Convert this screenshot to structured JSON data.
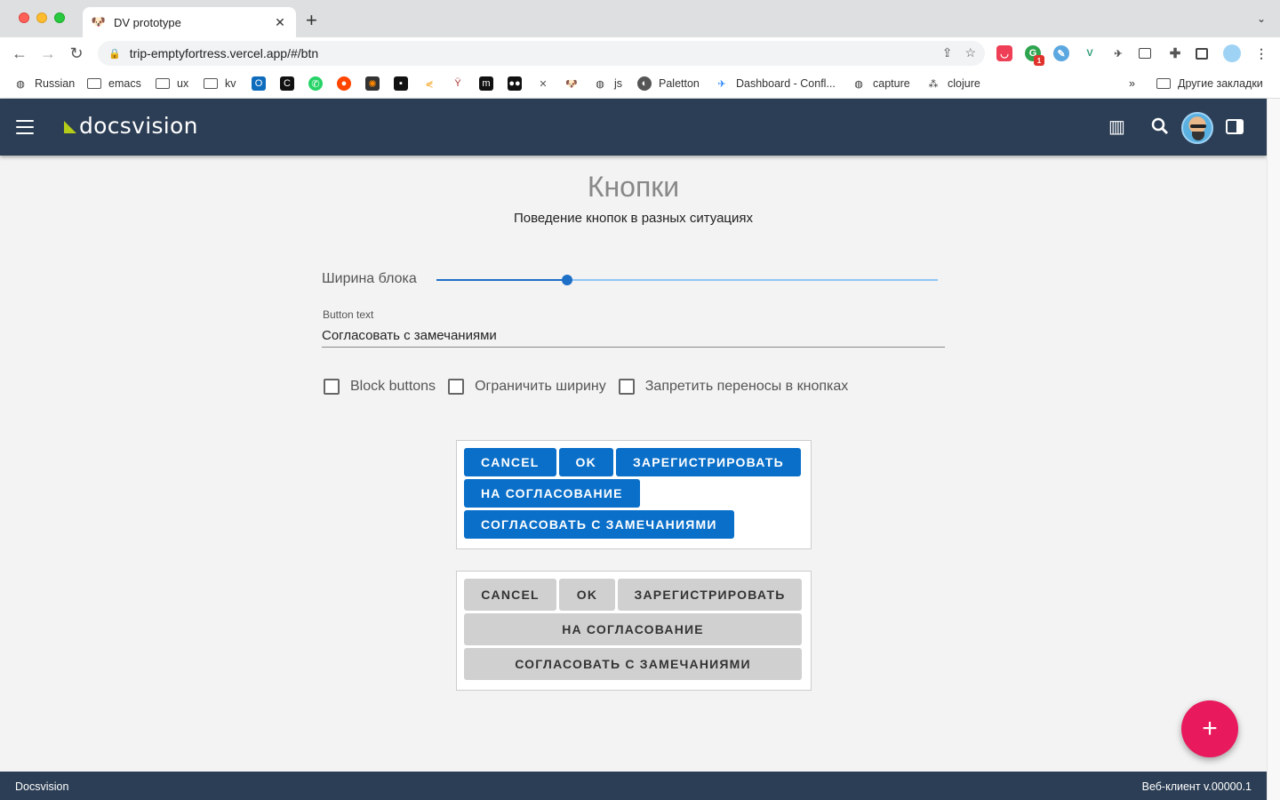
{
  "browser": {
    "tab_title": "DV prototype",
    "url": "trip-emptyfortress.vercel.app/#/btn",
    "new_tab": "+",
    "bookmarks": [
      "Russian",
      "emacs",
      "ux",
      "kv",
      "js",
      "Paletton",
      "Dashboard - Confl...",
      "capture",
      "clojure"
    ],
    "bookmarks_overflow": "»",
    "other_bookmarks": "Другие закладки",
    "ext_badge": "1"
  },
  "app": {
    "logo": "docsvision",
    "accent_color": "#2c3e55",
    "fab_color": "#e8195c"
  },
  "main": {
    "title": "Кнопки",
    "subtitle": "Поведение кнопок в разных ситуациях",
    "slider": {
      "label": "Ширина блока",
      "value_fraction": 0.26
    },
    "input": {
      "label": "Button text",
      "value": "Согласовать с замечаниями"
    },
    "checkboxes": [
      "Block buttons",
      "Ограничить ширину",
      "Запретить переносы в кнопках"
    ],
    "buttons": {
      "cancel": "CANCEL",
      "ok": "OK",
      "register": "ЗАРЕГИСТРИРОВАТЬ",
      "approve": "НА СОГЛАСОВАНИЕ",
      "approve_notes": "СОГЛАСОВАТЬ С ЗАМЕЧАНИЯМИ"
    },
    "fab": "+"
  },
  "footer": {
    "left": "Docsvision",
    "right": "Веб-клиент v.00000.1"
  }
}
